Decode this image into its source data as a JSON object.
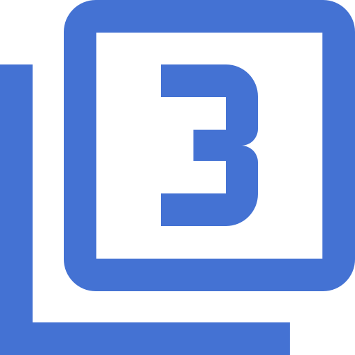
{
  "icon": {
    "name": "filter-3-icon",
    "color": "#4472D3"
  }
}
